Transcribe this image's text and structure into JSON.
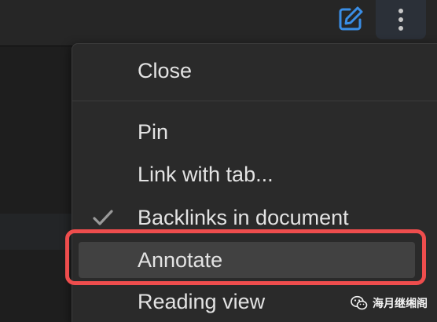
{
  "toolbar": {
    "edit_icon": "edit-icon",
    "more_icon": "more-vertical-icon"
  },
  "menu": {
    "items": [
      {
        "label": "Close",
        "checked": false
      },
      {
        "label": "Pin",
        "checked": false
      },
      {
        "label": "Link with tab...",
        "checked": false
      },
      {
        "label": "Backlinks in document",
        "checked": true
      },
      {
        "label": "Annotate",
        "checked": false,
        "highlighted": true
      },
      {
        "label": "Reading view",
        "checked": false
      }
    ]
  },
  "highlight_color": "#ee4d4d",
  "accent_color": "#3a8ee6",
  "watermark": {
    "text": "海月继缃阁",
    "icon": "wechat-icon"
  }
}
